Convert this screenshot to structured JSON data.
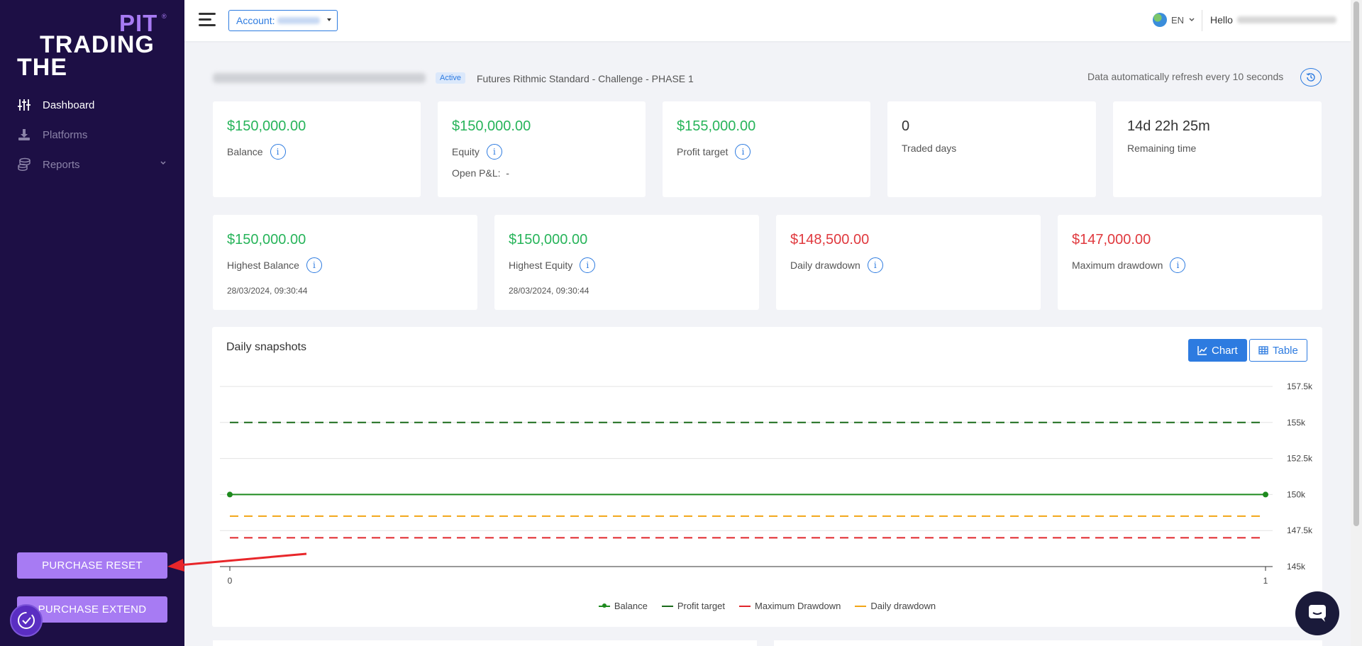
{
  "sidebar": {
    "logo": {
      "pit": "PIT",
      "registered": "®",
      "trading": "TRADING",
      "the": "THE"
    },
    "items": [
      {
        "label": "Dashboard",
        "icon": "sliders-icon",
        "active": true
      },
      {
        "label": "Platforms",
        "icon": "download-icon",
        "active": false
      },
      {
        "label": "Reports",
        "icon": "coins-icon",
        "active": false
      }
    ],
    "purchase_reset": "PURCHASE RESET",
    "purchase_extend": "PURCHASE EXTEND"
  },
  "header": {
    "account_label": "Account:",
    "language": "EN",
    "hello": "Hello"
  },
  "title_row": {
    "status": "Active",
    "account_type": "Futures Rithmic Standard - Challenge - PHASE 1",
    "refresh_text": "Data automatically refresh every 10 seconds"
  },
  "cards_row1": [
    {
      "value": "$150,000.00",
      "label": "Balance",
      "color": "green",
      "info": true
    },
    {
      "value": "$150,000.00",
      "label": "Equity",
      "color": "green",
      "info": true,
      "extra_label": "Open P&L:",
      "extra_value": "-"
    },
    {
      "value": "$155,000.00",
      "label": "Profit target",
      "color": "green",
      "info": true
    },
    {
      "value": "0",
      "label": "Traded days",
      "color": "dark",
      "info": false
    },
    {
      "value": "14d 22h 25m",
      "label": "Remaining time",
      "color": "dark",
      "info": false
    }
  ],
  "cards_row2": [
    {
      "value": "$150,000.00",
      "label": "Highest Balance",
      "color": "green",
      "info": true,
      "sub": "28/03/2024, 09:30:44"
    },
    {
      "value": "$150,000.00",
      "label": "Highest Equity",
      "color": "green",
      "info": true,
      "sub": "28/03/2024, 09:30:44"
    },
    {
      "value": "$148,500.00",
      "label": "Daily drawdown",
      "color": "red",
      "info": true
    },
    {
      "value": "$147,000.00",
      "label": "Maximum drawdown",
      "color": "red",
      "info": true
    }
  ],
  "snapshots": {
    "title": "Daily snapshots",
    "chart_tab": "Chart",
    "table_tab": "Table"
  },
  "chart_data": {
    "type": "line",
    "x": [
      0,
      1
    ],
    "x_ticks": [
      "0",
      "1"
    ],
    "ylim": [
      145000,
      157500
    ],
    "y_ticks": [
      "145k",
      "147.5k",
      "150k",
      "152.5k",
      "155k",
      "157.5k"
    ],
    "y_tick_values": [
      145000,
      147500,
      150000,
      152500,
      155000,
      157500
    ],
    "grid": true,
    "legend_position": "bottom",
    "series": [
      {
        "name": "Balance",
        "values": [
          150000,
          150000
        ],
        "color": "#1e8a1e",
        "style": "solid",
        "markers": true
      },
      {
        "name": "Profit target",
        "values": [
          155000,
          155000
        ],
        "color": "#1a6b1a",
        "style": "dashed",
        "markers": false
      },
      {
        "name": "Maximum Drawdown",
        "values": [
          147000,
          147000
        ],
        "color": "#e0262b",
        "style": "dashed",
        "markers": false
      },
      {
        "name": "Daily drawdown",
        "values": [
          148500,
          148500
        ],
        "color": "#f2a516",
        "style": "dashed",
        "markers": false
      }
    ]
  },
  "colors": {
    "sidebar_bg": "#1d0f45",
    "accent_purple": "#a77bf3",
    "primary_blue": "#2d7be0",
    "green": "#27b45a",
    "red": "#e0393e"
  }
}
